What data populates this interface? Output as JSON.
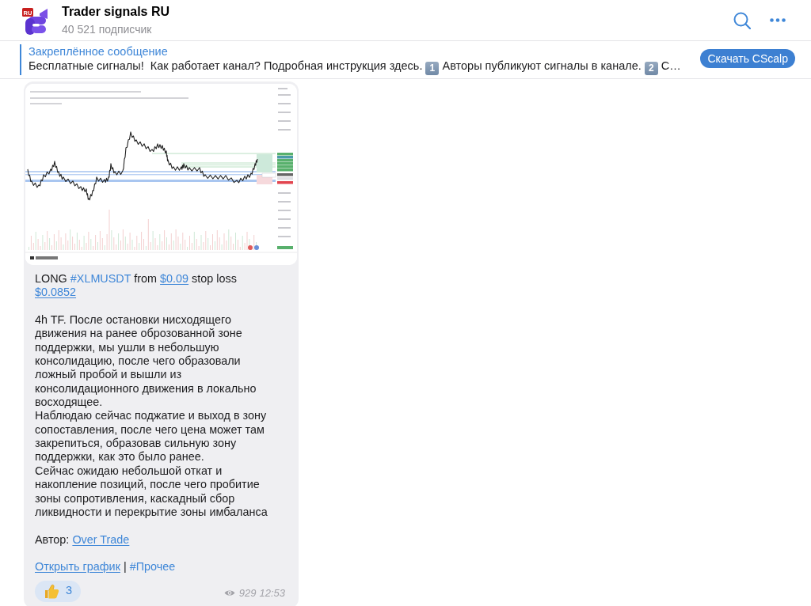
{
  "header": {
    "title": "Trader signals RU",
    "subscribers": "40 521 подписчик",
    "logo_badge": "RU"
  },
  "pinned": {
    "label": "Закреплённое сообщение",
    "segments": [
      {
        "kind": "text",
        "text": "Бесплатные сигналы!  Как работает канал? Подробная инструкция здесь. "
      },
      {
        "kind": "keycap",
        "text": "1"
      },
      {
        "kind": "text",
        "text": " Авторы публикуют сигналы в канале. "
      },
      {
        "kind": "keycap",
        "text": "2"
      },
      {
        "kind": "text",
        "text": " С…"
      }
    ],
    "button": "Скачать CScalp"
  },
  "message": {
    "headline": [
      {
        "kind": "text",
        "text": "LONG "
      },
      {
        "kind": "hashtag",
        "text": "#XLMUSDT"
      },
      {
        "kind": "text",
        "text": " from "
      },
      {
        "kind": "link",
        "text": "$0.09"
      },
      {
        "kind": "text",
        "text": " stop loss "
      },
      {
        "kind": "link",
        "text": "$0.0852"
      }
    ],
    "body": [
      "4h TF. После остановки нисходящего движения на ранее оброзованной зоне поддержки, мы ушли в небольшую консолидацию, после чего образовали ложный пробой и вышли из консолидационного движения в локально восходящее.",
      "Наблюдаю сейчас поджатие и выход в зону сопоставления, после чего цена может там закрепиться, образовав сильную зону поддержки, как это было ранее.",
      "Сейчас ожидаю небольшой откат и накопление позиций, после чего пробитие зоны сопротивления, каскадный сбор ликвидности и перекрытие зоны имбаланса"
    ],
    "author": [
      {
        "kind": "text",
        "text": "Автор: "
      },
      {
        "kind": "link",
        "text": "Over Trade"
      }
    ],
    "links": [
      {
        "kind": "link",
        "text": "Открыть график"
      },
      {
        "kind": "text",
        "text": " | "
      },
      {
        "kind": "hashtag",
        "text": "#Прочее"
      }
    ],
    "reaction": {
      "count": "3"
    },
    "views": "929",
    "time": "12:53"
  }
}
